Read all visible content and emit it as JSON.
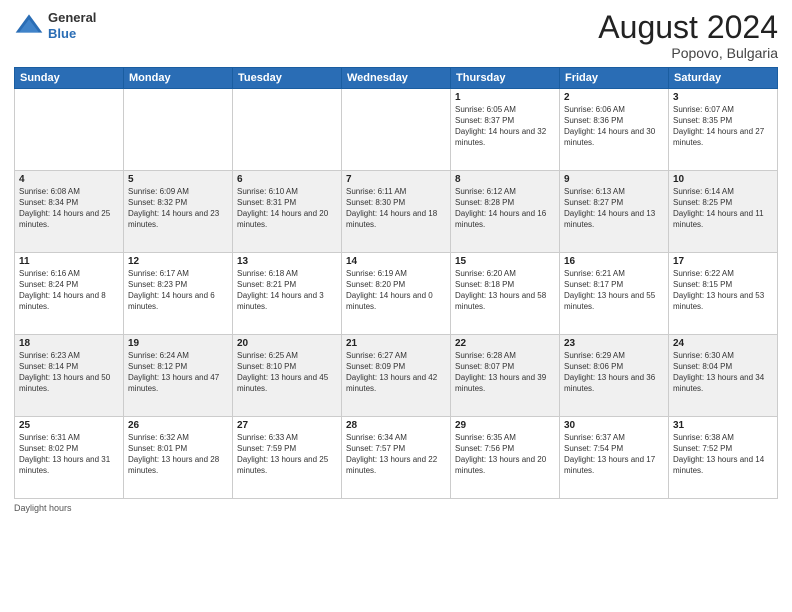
{
  "header": {
    "logo_line1": "General",
    "logo_line2": "Blue",
    "month_year": "August 2024",
    "location": "Popovo, Bulgaria"
  },
  "days_of_week": [
    "Sunday",
    "Monday",
    "Tuesday",
    "Wednesday",
    "Thursday",
    "Friday",
    "Saturday"
  ],
  "weeks": [
    [
      {
        "day": "",
        "sunrise": "",
        "sunset": "",
        "daylight": ""
      },
      {
        "day": "",
        "sunrise": "",
        "sunset": "",
        "daylight": ""
      },
      {
        "day": "",
        "sunrise": "",
        "sunset": "",
        "daylight": ""
      },
      {
        "day": "",
        "sunrise": "",
        "sunset": "",
        "daylight": ""
      },
      {
        "day": "1",
        "sunrise": "Sunrise: 6:05 AM",
        "sunset": "Sunset: 8:37 PM",
        "daylight": "Daylight: 14 hours and 32 minutes."
      },
      {
        "day": "2",
        "sunrise": "Sunrise: 6:06 AM",
        "sunset": "Sunset: 8:36 PM",
        "daylight": "Daylight: 14 hours and 30 minutes."
      },
      {
        "day": "3",
        "sunrise": "Sunrise: 6:07 AM",
        "sunset": "Sunset: 8:35 PM",
        "daylight": "Daylight: 14 hours and 27 minutes."
      }
    ],
    [
      {
        "day": "4",
        "sunrise": "Sunrise: 6:08 AM",
        "sunset": "Sunset: 8:34 PM",
        "daylight": "Daylight: 14 hours and 25 minutes."
      },
      {
        "day": "5",
        "sunrise": "Sunrise: 6:09 AM",
        "sunset": "Sunset: 8:32 PM",
        "daylight": "Daylight: 14 hours and 23 minutes."
      },
      {
        "day": "6",
        "sunrise": "Sunrise: 6:10 AM",
        "sunset": "Sunset: 8:31 PM",
        "daylight": "Daylight: 14 hours and 20 minutes."
      },
      {
        "day": "7",
        "sunrise": "Sunrise: 6:11 AM",
        "sunset": "Sunset: 8:30 PM",
        "daylight": "Daylight: 14 hours and 18 minutes."
      },
      {
        "day": "8",
        "sunrise": "Sunrise: 6:12 AM",
        "sunset": "Sunset: 8:28 PM",
        "daylight": "Daylight: 14 hours and 16 minutes."
      },
      {
        "day": "9",
        "sunrise": "Sunrise: 6:13 AM",
        "sunset": "Sunset: 8:27 PM",
        "daylight": "Daylight: 14 hours and 13 minutes."
      },
      {
        "day": "10",
        "sunrise": "Sunrise: 6:14 AM",
        "sunset": "Sunset: 8:25 PM",
        "daylight": "Daylight: 14 hours and 11 minutes."
      }
    ],
    [
      {
        "day": "11",
        "sunrise": "Sunrise: 6:16 AM",
        "sunset": "Sunset: 8:24 PM",
        "daylight": "Daylight: 14 hours and 8 minutes."
      },
      {
        "day": "12",
        "sunrise": "Sunrise: 6:17 AM",
        "sunset": "Sunset: 8:23 PM",
        "daylight": "Daylight: 14 hours and 6 minutes."
      },
      {
        "day": "13",
        "sunrise": "Sunrise: 6:18 AM",
        "sunset": "Sunset: 8:21 PM",
        "daylight": "Daylight: 14 hours and 3 minutes."
      },
      {
        "day": "14",
        "sunrise": "Sunrise: 6:19 AM",
        "sunset": "Sunset: 8:20 PM",
        "daylight": "Daylight: 14 hours and 0 minutes."
      },
      {
        "day": "15",
        "sunrise": "Sunrise: 6:20 AM",
        "sunset": "Sunset: 8:18 PM",
        "daylight": "Daylight: 13 hours and 58 minutes."
      },
      {
        "day": "16",
        "sunrise": "Sunrise: 6:21 AM",
        "sunset": "Sunset: 8:17 PM",
        "daylight": "Daylight: 13 hours and 55 minutes."
      },
      {
        "day": "17",
        "sunrise": "Sunrise: 6:22 AM",
        "sunset": "Sunset: 8:15 PM",
        "daylight": "Daylight: 13 hours and 53 minutes."
      }
    ],
    [
      {
        "day": "18",
        "sunrise": "Sunrise: 6:23 AM",
        "sunset": "Sunset: 8:14 PM",
        "daylight": "Daylight: 13 hours and 50 minutes."
      },
      {
        "day": "19",
        "sunrise": "Sunrise: 6:24 AM",
        "sunset": "Sunset: 8:12 PM",
        "daylight": "Daylight: 13 hours and 47 minutes."
      },
      {
        "day": "20",
        "sunrise": "Sunrise: 6:25 AM",
        "sunset": "Sunset: 8:10 PM",
        "daylight": "Daylight: 13 hours and 45 minutes."
      },
      {
        "day": "21",
        "sunrise": "Sunrise: 6:27 AM",
        "sunset": "Sunset: 8:09 PM",
        "daylight": "Daylight: 13 hours and 42 minutes."
      },
      {
        "day": "22",
        "sunrise": "Sunrise: 6:28 AM",
        "sunset": "Sunset: 8:07 PM",
        "daylight": "Daylight: 13 hours and 39 minutes."
      },
      {
        "day": "23",
        "sunrise": "Sunrise: 6:29 AM",
        "sunset": "Sunset: 8:06 PM",
        "daylight": "Daylight: 13 hours and 36 minutes."
      },
      {
        "day": "24",
        "sunrise": "Sunrise: 6:30 AM",
        "sunset": "Sunset: 8:04 PM",
        "daylight": "Daylight: 13 hours and 34 minutes."
      }
    ],
    [
      {
        "day": "25",
        "sunrise": "Sunrise: 6:31 AM",
        "sunset": "Sunset: 8:02 PM",
        "daylight": "Daylight: 13 hours and 31 minutes."
      },
      {
        "day": "26",
        "sunrise": "Sunrise: 6:32 AM",
        "sunset": "Sunset: 8:01 PM",
        "daylight": "Daylight: 13 hours and 28 minutes."
      },
      {
        "day": "27",
        "sunrise": "Sunrise: 6:33 AM",
        "sunset": "Sunset: 7:59 PM",
        "daylight": "Daylight: 13 hours and 25 minutes."
      },
      {
        "day": "28",
        "sunrise": "Sunrise: 6:34 AM",
        "sunset": "Sunset: 7:57 PM",
        "daylight": "Daylight: 13 hours and 22 minutes."
      },
      {
        "day": "29",
        "sunrise": "Sunrise: 6:35 AM",
        "sunset": "Sunset: 7:56 PM",
        "daylight": "Daylight: 13 hours and 20 minutes."
      },
      {
        "day": "30",
        "sunrise": "Sunrise: 6:37 AM",
        "sunset": "Sunset: 7:54 PM",
        "daylight": "Daylight: 13 hours and 17 minutes."
      },
      {
        "day": "31",
        "sunrise": "Sunrise: 6:38 AM",
        "sunset": "Sunset: 7:52 PM",
        "daylight": "Daylight: 13 hours and 14 minutes."
      }
    ]
  ],
  "footer": {
    "daylight_hours": "Daylight hours"
  }
}
